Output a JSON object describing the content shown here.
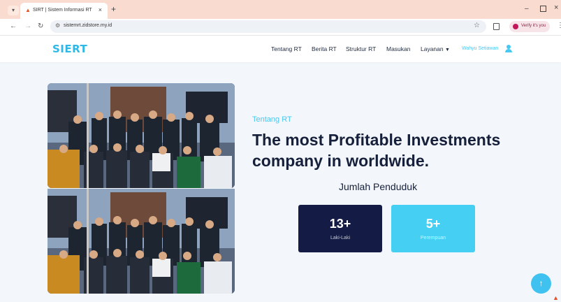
{
  "browser": {
    "tab_title": "SIRT | Sistem Informasi RT",
    "url": "sistemrt.zidstore.my.id",
    "profile_label": "Verify it's you"
  },
  "site": {
    "logo": "SIERT",
    "nav": [
      "Tentang RT",
      "Berita RT",
      "Struktur RT",
      "Masukan",
      "Layanan"
    ],
    "user_name": "Wahyu Setiawan"
  },
  "about": {
    "label": "Tentang RT",
    "headline": "The most Profitable Investments company in worldwide.",
    "population_title": "Jumlah Penduduk",
    "stats": [
      {
        "value": "13+",
        "label": "Laki-Laki"
      },
      {
        "value": "5+",
        "label": "Perempuan"
      }
    ]
  },
  "icons": {
    "favicon": "flame-icon",
    "scroll_top": "arrow-up-icon",
    "user": "user-icon"
  },
  "colors": {
    "accent": "#45c9f2",
    "dark_card": "#141c46",
    "light_card": "#45d0f3",
    "tab_strip": "#f9dccf"
  }
}
